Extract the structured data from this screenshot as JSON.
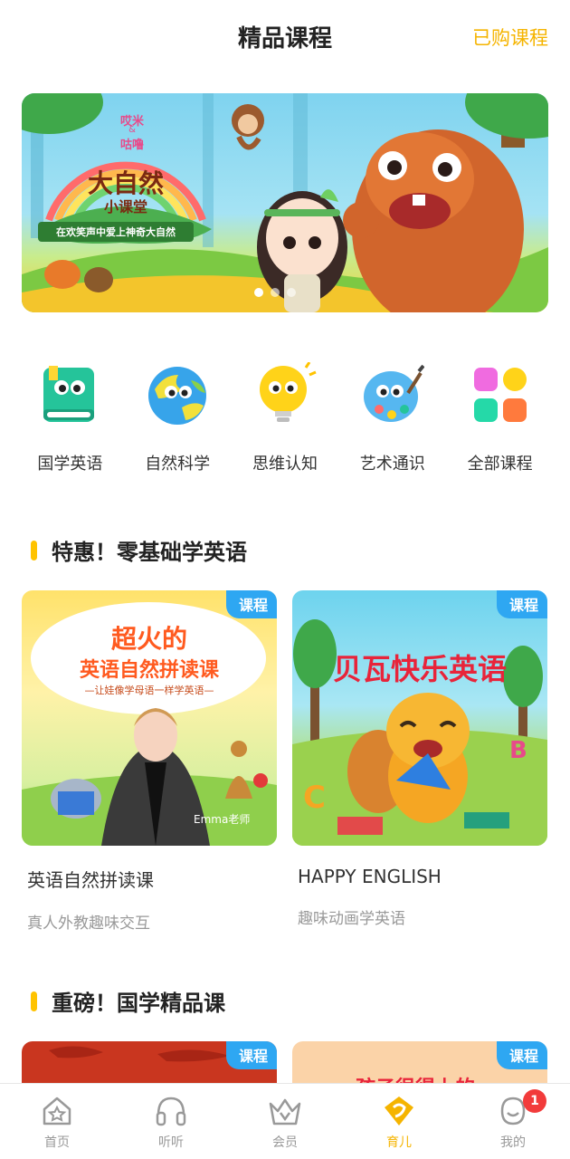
{
  "header": {
    "title": "精品课程",
    "purchased": "已购课程"
  },
  "banner": {
    "logo_top": "哎米",
    "logo_mid": "&",
    "logo_bottom": "咕噜",
    "heading": "大自然",
    "subheading": "小课堂",
    "slogan": "在欢笑声中爱上神奇大自然"
  },
  "categories": [
    {
      "label": "国学英语",
      "icon": "green-book-icon"
    },
    {
      "label": "自然科学",
      "icon": "earth-globe-icon"
    },
    {
      "label": "思维认知",
      "icon": "lightbulb-icon"
    },
    {
      "label": "艺术通识",
      "icon": "paint-palette-icon"
    },
    {
      "label": "全部课程",
      "icon": "all-courses-grid-icon"
    }
  ],
  "section1": {
    "title": "特惠！零基础学英语",
    "cards": [
      {
        "tag": "课程",
        "title": "英语自然拼读课",
        "subtitle": "真人外教趣味交互",
        "poster_line1": "超火的",
        "poster_line2": "英语自然拼读课",
        "poster_line3": "—让娃像学母语一样学英语—",
        "poster_teacher": "Emma老师"
      },
      {
        "tag": "课程",
        "title": "HAPPY ENGLISH",
        "subtitle": "趣味动画学英语",
        "poster_line1": "贝瓦快乐英语"
      }
    ]
  },
  "section2": {
    "title": "重磅！国学精品课",
    "cards": [
      {
        "tag": "课程"
      },
      {
        "tag": "课程",
        "poster_fragment": "孩子很得上的"
      }
    ]
  },
  "tabbar": {
    "items": [
      {
        "label": "首页",
        "icon": "home-icon"
      },
      {
        "label": "听听",
        "icon": "headphones-icon"
      },
      {
        "label": "会员",
        "icon": "vip-crown-icon"
      },
      {
        "label": "育儿",
        "icon": "parenting-icon",
        "active": true
      },
      {
        "label": "我的",
        "icon": "profile-icon"
      }
    ],
    "badge": "1"
  },
  "colors": {
    "accent": "#f5b400",
    "tag_blue": "#2ea7f2",
    "badge_red": "#f23b3b"
  }
}
